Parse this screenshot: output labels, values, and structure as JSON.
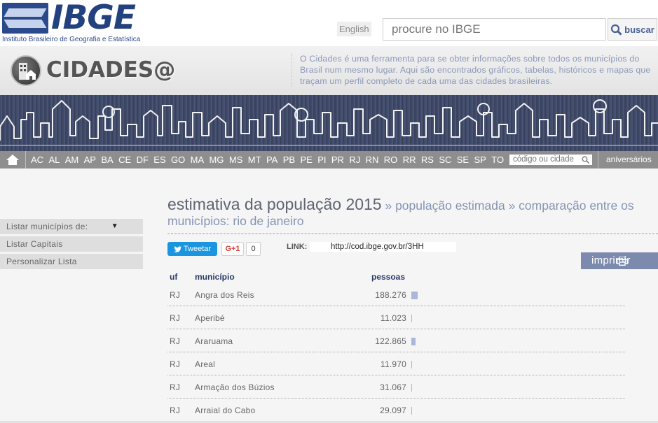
{
  "header": {
    "logo_word": "IBGE",
    "logo_subtitle": "Instituto Brasileiro de Geografia e Estatística",
    "lang_link": "English",
    "search_placeholder": "procure no IBGE",
    "search_button": "buscar"
  },
  "band": {
    "brand": "CIDADES@",
    "description": "O Cidades é uma ferramenta para se obter informações sobre todos os municípios do Brasil num mesmo lugar. Aqui são encontrados gráficos, tabelas, históricos e mapas que traçam um perfil completo de cada uma das cidades brasileiras."
  },
  "states_bar": {
    "ufs": [
      "AC",
      "AL",
      "AM",
      "AP",
      "BA",
      "CE",
      "DF",
      "ES",
      "GO",
      "MA",
      "MG",
      "MS",
      "MT",
      "PA",
      "PB",
      "PE",
      "PI",
      "PR",
      "RJ",
      "RN",
      "RO",
      "RR",
      "RS",
      "SC",
      "SE",
      "SP",
      "TO"
    ],
    "code_placeholder": "código ou cidade",
    "anniversaries": "aniversários"
  },
  "sidebar": {
    "items": [
      {
        "label": "Listar municípios de:"
      },
      {
        "label": "Listar Capitais"
      },
      {
        "label": "Personalizar Lista"
      }
    ]
  },
  "main": {
    "title": "estimativa da população 2015",
    "crumb": " » população estimada » comparação entre os municípios: rio de janeiro",
    "tweet_label": "Tweetar",
    "gplus_label": "G+1",
    "gplus_count": "0",
    "link_label": "LINK:",
    "link_value": "http://cod.ibge.gov.br/3HH",
    "print_label": "imprimir",
    "columns": {
      "uf": "uf",
      "municipio": "município",
      "pessoas": "pessoas"
    },
    "rows": [
      {
        "uf": "RJ",
        "municipio": "Angra dos Reis",
        "pessoas": "188.276",
        "value": 188276
      },
      {
        "uf": "RJ",
        "municipio": "Aperibé",
        "pessoas": "11.023",
        "value": 11023
      },
      {
        "uf": "RJ",
        "municipio": "Araruama",
        "pessoas": "122.865",
        "value": 122865
      },
      {
        "uf": "RJ",
        "municipio": "Areal",
        "pessoas": "11.970",
        "value": 11970
      },
      {
        "uf": "RJ",
        "municipio": "Armação dos Búzios",
        "pessoas": "31.067",
        "value": 31067
      },
      {
        "uf": "RJ",
        "municipio": "Arraial do Cabo",
        "pessoas": "29.097",
        "value": 29097
      }
    ]
  },
  "colors": {
    "brand_blue": "#23407f",
    "accent_lavender": "#7c8aae",
    "bar": "#a9b7d8",
    "states_bar": "#8e8e8e"
  }
}
